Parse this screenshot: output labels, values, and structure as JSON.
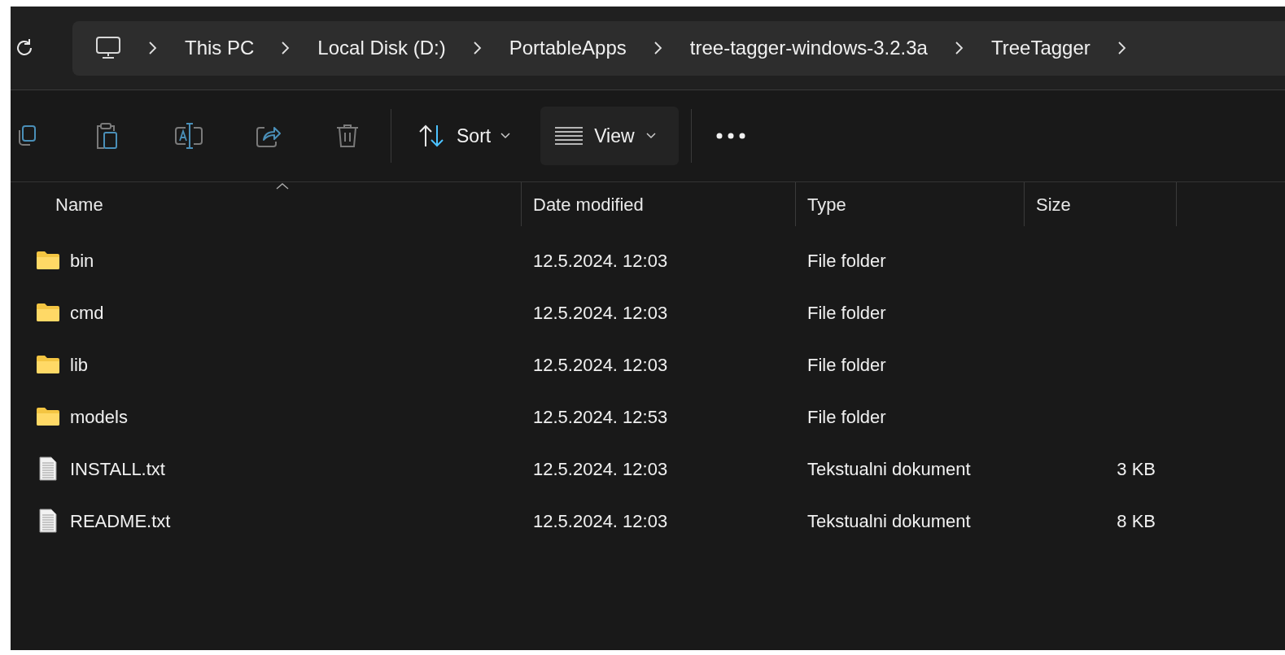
{
  "address_bar": {
    "path": [
      "This PC",
      "Local Disk (D:)",
      "PortableApps",
      "tree-tagger-windows-3.2.3a",
      "TreeTagger"
    ]
  },
  "toolbar": {
    "sort": {
      "label": "Sort"
    },
    "view": {
      "label": "View"
    }
  },
  "file_list": {
    "columns": [
      {
        "label": "Name",
        "sorted": true
      },
      {
        "label": "Date modified",
        "sorted": false
      },
      {
        "label": "Type",
        "sorted": false
      },
      {
        "label": "Size",
        "sorted": false
      }
    ],
    "rows": [
      {
        "kind": "folder",
        "name": "bin",
        "date": "12.5.2024. 12:03",
        "type": "File folder"
      },
      {
        "kind": "folder",
        "name": "cmd",
        "date": "12.5.2024. 12:03",
        "type": "File folder"
      },
      {
        "kind": "folder",
        "name": "lib",
        "date": "12.5.2024. 12:03",
        "type": "File folder"
      },
      {
        "kind": "folder",
        "name": "models",
        "date": "12.5.2024. 12:53",
        "type": "File folder"
      },
      {
        "kind": "file",
        "name": "INSTALL.txt",
        "date": "12.5.2024. 12:03",
        "type": "Tekstualni dokument",
        "size": "3 KB"
      },
      {
        "kind": "file",
        "name": "README.txt",
        "date": "12.5.2024. 12:03",
        "type": "Tekstualni dokument",
        "size": "8 KB"
      }
    ]
  }
}
